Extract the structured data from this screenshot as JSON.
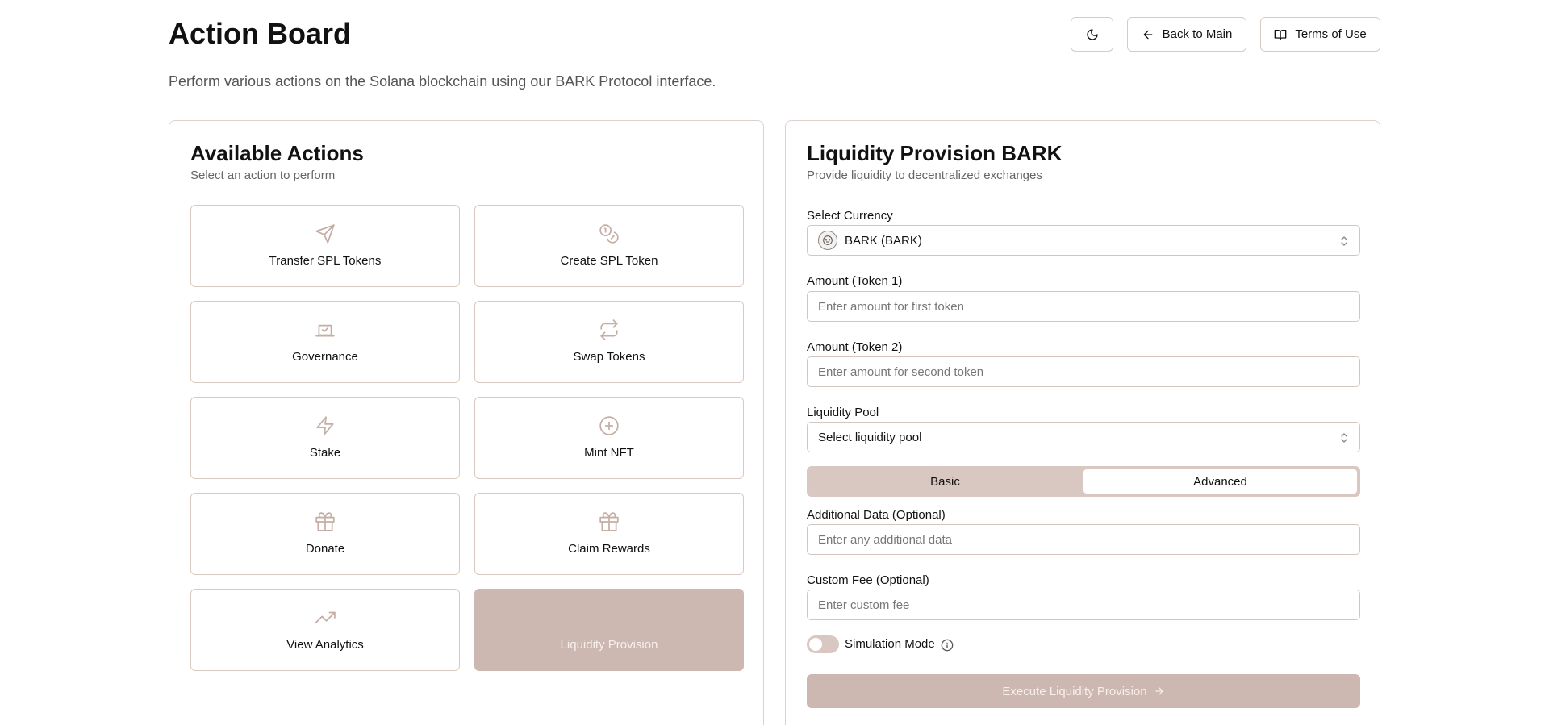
{
  "header": {
    "title": "Action Board",
    "description": "Perform various actions on the Solana blockchain using our BARK Protocol interface.",
    "back_label": "Back to Main",
    "terms_label": "Terms of Use"
  },
  "actions_panel": {
    "title": "Available Actions",
    "subtitle": "Select an action to perform",
    "items": [
      {
        "label": "Transfer SPL Tokens",
        "icon": "send-icon"
      },
      {
        "label": "Create SPL Token",
        "icon": "coins-icon"
      },
      {
        "label": "Governance",
        "icon": "vote-icon"
      },
      {
        "label": "Swap Tokens",
        "icon": "repeat-icon"
      },
      {
        "label": "Stake",
        "icon": "zap-icon"
      },
      {
        "label": "Mint NFT",
        "icon": "plus-circle-icon"
      },
      {
        "label": "Donate",
        "icon": "gift-icon"
      },
      {
        "label": "Claim Rewards",
        "icon": "gift-icon"
      },
      {
        "label": "View Analytics",
        "icon": "trending-up-icon"
      },
      {
        "label": "Liquidity Provision",
        "icon": "none",
        "selected": true
      }
    ]
  },
  "form": {
    "title": "Liquidity Provision BARK",
    "subtitle": "Provide liquidity to decentralized exchanges",
    "currency_label": "Select Currency",
    "currency_value": "BARK (BARK)",
    "amount1_label": "Amount (Token 1)",
    "amount1_placeholder": "Enter amount for first token",
    "amount2_label": "Amount (Token 2)",
    "amount2_placeholder": "Enter amount for second token",
    "pool_label": "Liquidity Pool",
    "pool_value": "Select liquidity pool",
    "tabs": [
      "Basic",
      "Advanced"
    ],
    "active_tab": "Advanced",
    "additional_label": "Additional Data (Optional)",
    "additional_placeholder": "Enter any additional data",
    "fee_label": "Custom Fee (Optional)",
    "fee_placeholder": "Enter custom fee",
    "simulation_label": "Simulation Mode",
    "simulation_on": false,
    "execute_label": "Execute Liquidity Provision"
  },
  "colors": {
    "accent": "#cdb8b1",
    "accent_light": "#d9c8c2",
    "border": "#d8c9c3",
    "icon": "#c5aea6"
  }
}
